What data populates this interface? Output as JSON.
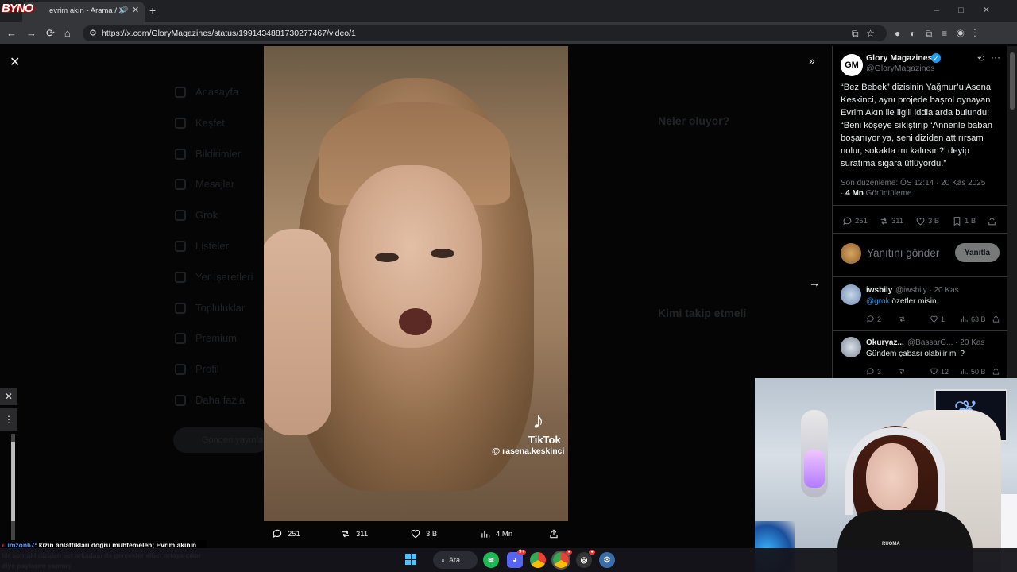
{
  "browser": {
    "tab_title": "evrim akın - Arama / X",
    "url": "https://x.com/GloryMagazines/status/1991434881730277467/video/1",
    "overlay_logo": "BYNO"
  },
  "background_page": {
    "nav_items": [
      "Anasayfa",
      "Keşfet",
      "Bildirimler",
      "Mesajlar",
      "Grok",
      "Listeler",
      "Yer İşaretleri",
      "Topluluklar",
      "Premium",
      "Profil",
      "Daha fazla"
    ],
    "post_button": "Gönderi yayınla",
    "trending_header": "Neler oluyor?",
    "follow_header": "Kimi takip etmeli"
  },
  "video": {
    "tiktok_label": "TikTok",
    "tiktok_user": "@ rasena.keskinci",
    "actions": {
      "replies": "251",
      "reposts": "311",
      "likes": "3 B",
      "views": "4 Mn"
    }
  },
  "post": {
    "author": "Glory Magazines",
    "avatar_text": "GM",
    "handle": "@GloryMagazines",
    "text": "“Bez Bebek” dizisinin Yağmur’u Asena Keskinci, aynı projede başrol oynayan Evrim Akın ile ilgili iddialarda bulundu: “Beni köşeye sıkıştırıp ‘Annenle baban boşanıyor ya, seni diziden attırırsam nolur, sokakta mı kalırsın?’ deyip suratıma sigara üflüyordu.”",
    "edited": "Son düzenleme: ÖS 12:14 · 20 Kas 2025",
    "views_count": "4 Mn",
    "views_label": "Görüntüleme",
    "stats": {
      "replies": "251",
      "reposts": "311",
      "likes": "3 B",
      "bookmarks": "1 B"
    },
    "reply_placeholder": "Yanıtını gönder",
    "reply_button": "Yanıtla"
  },
  "comments": [
    {
      "name": "iwsbily",
      "handle": "@iwsbily",
      "date": "· 20 Kas",
      "mention": "@grok",
      "text": " özetler misin",
      "replies": "2",
      "reposts": "",
      "likes": "1",
      "views": "63 B"
    },
    {
      "name": "Okuryaz...",
      "handle": "@BassarG...",
      "date": "· 20 Kas",
      "mention": "",
      "text": "Gündem çabası olabilir mi ?",
      "replies": "3",
      "reposts": "",
      "likes": "12",
      "views": "50 B"
    }
  ],
  "chat": {
    "user": "imzon67",
    "message": ": kızın anlattıkları doğru muhtemelen; Evrim akının bir sonraki diziden set arkadaşı da gerçekler elbet ortaya çıkar diye paylaşım yapmış"
  },
  "webcam": {
    "shirt_text": "RUOMA"
  },
  "taskbar": {
    "search_label": "Ara"
  }
}
